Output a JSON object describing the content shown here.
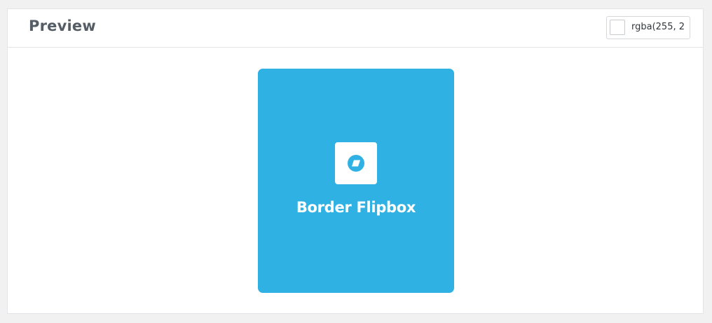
{
  "header": {
    "title": "Preview"
  },
  "color_picker": {
    "value": "rgba(255, 2",
    "swatch_color": "#ffffff"
  },
  "flipbox": {
    "title": "Border Flipbox",
    "icon": "skewed-square-badge-icon",
    "background_color": "#30b1e4",
    "icon_background": "#ffffff",
    "title_color": "#ffffff"
  }
}
